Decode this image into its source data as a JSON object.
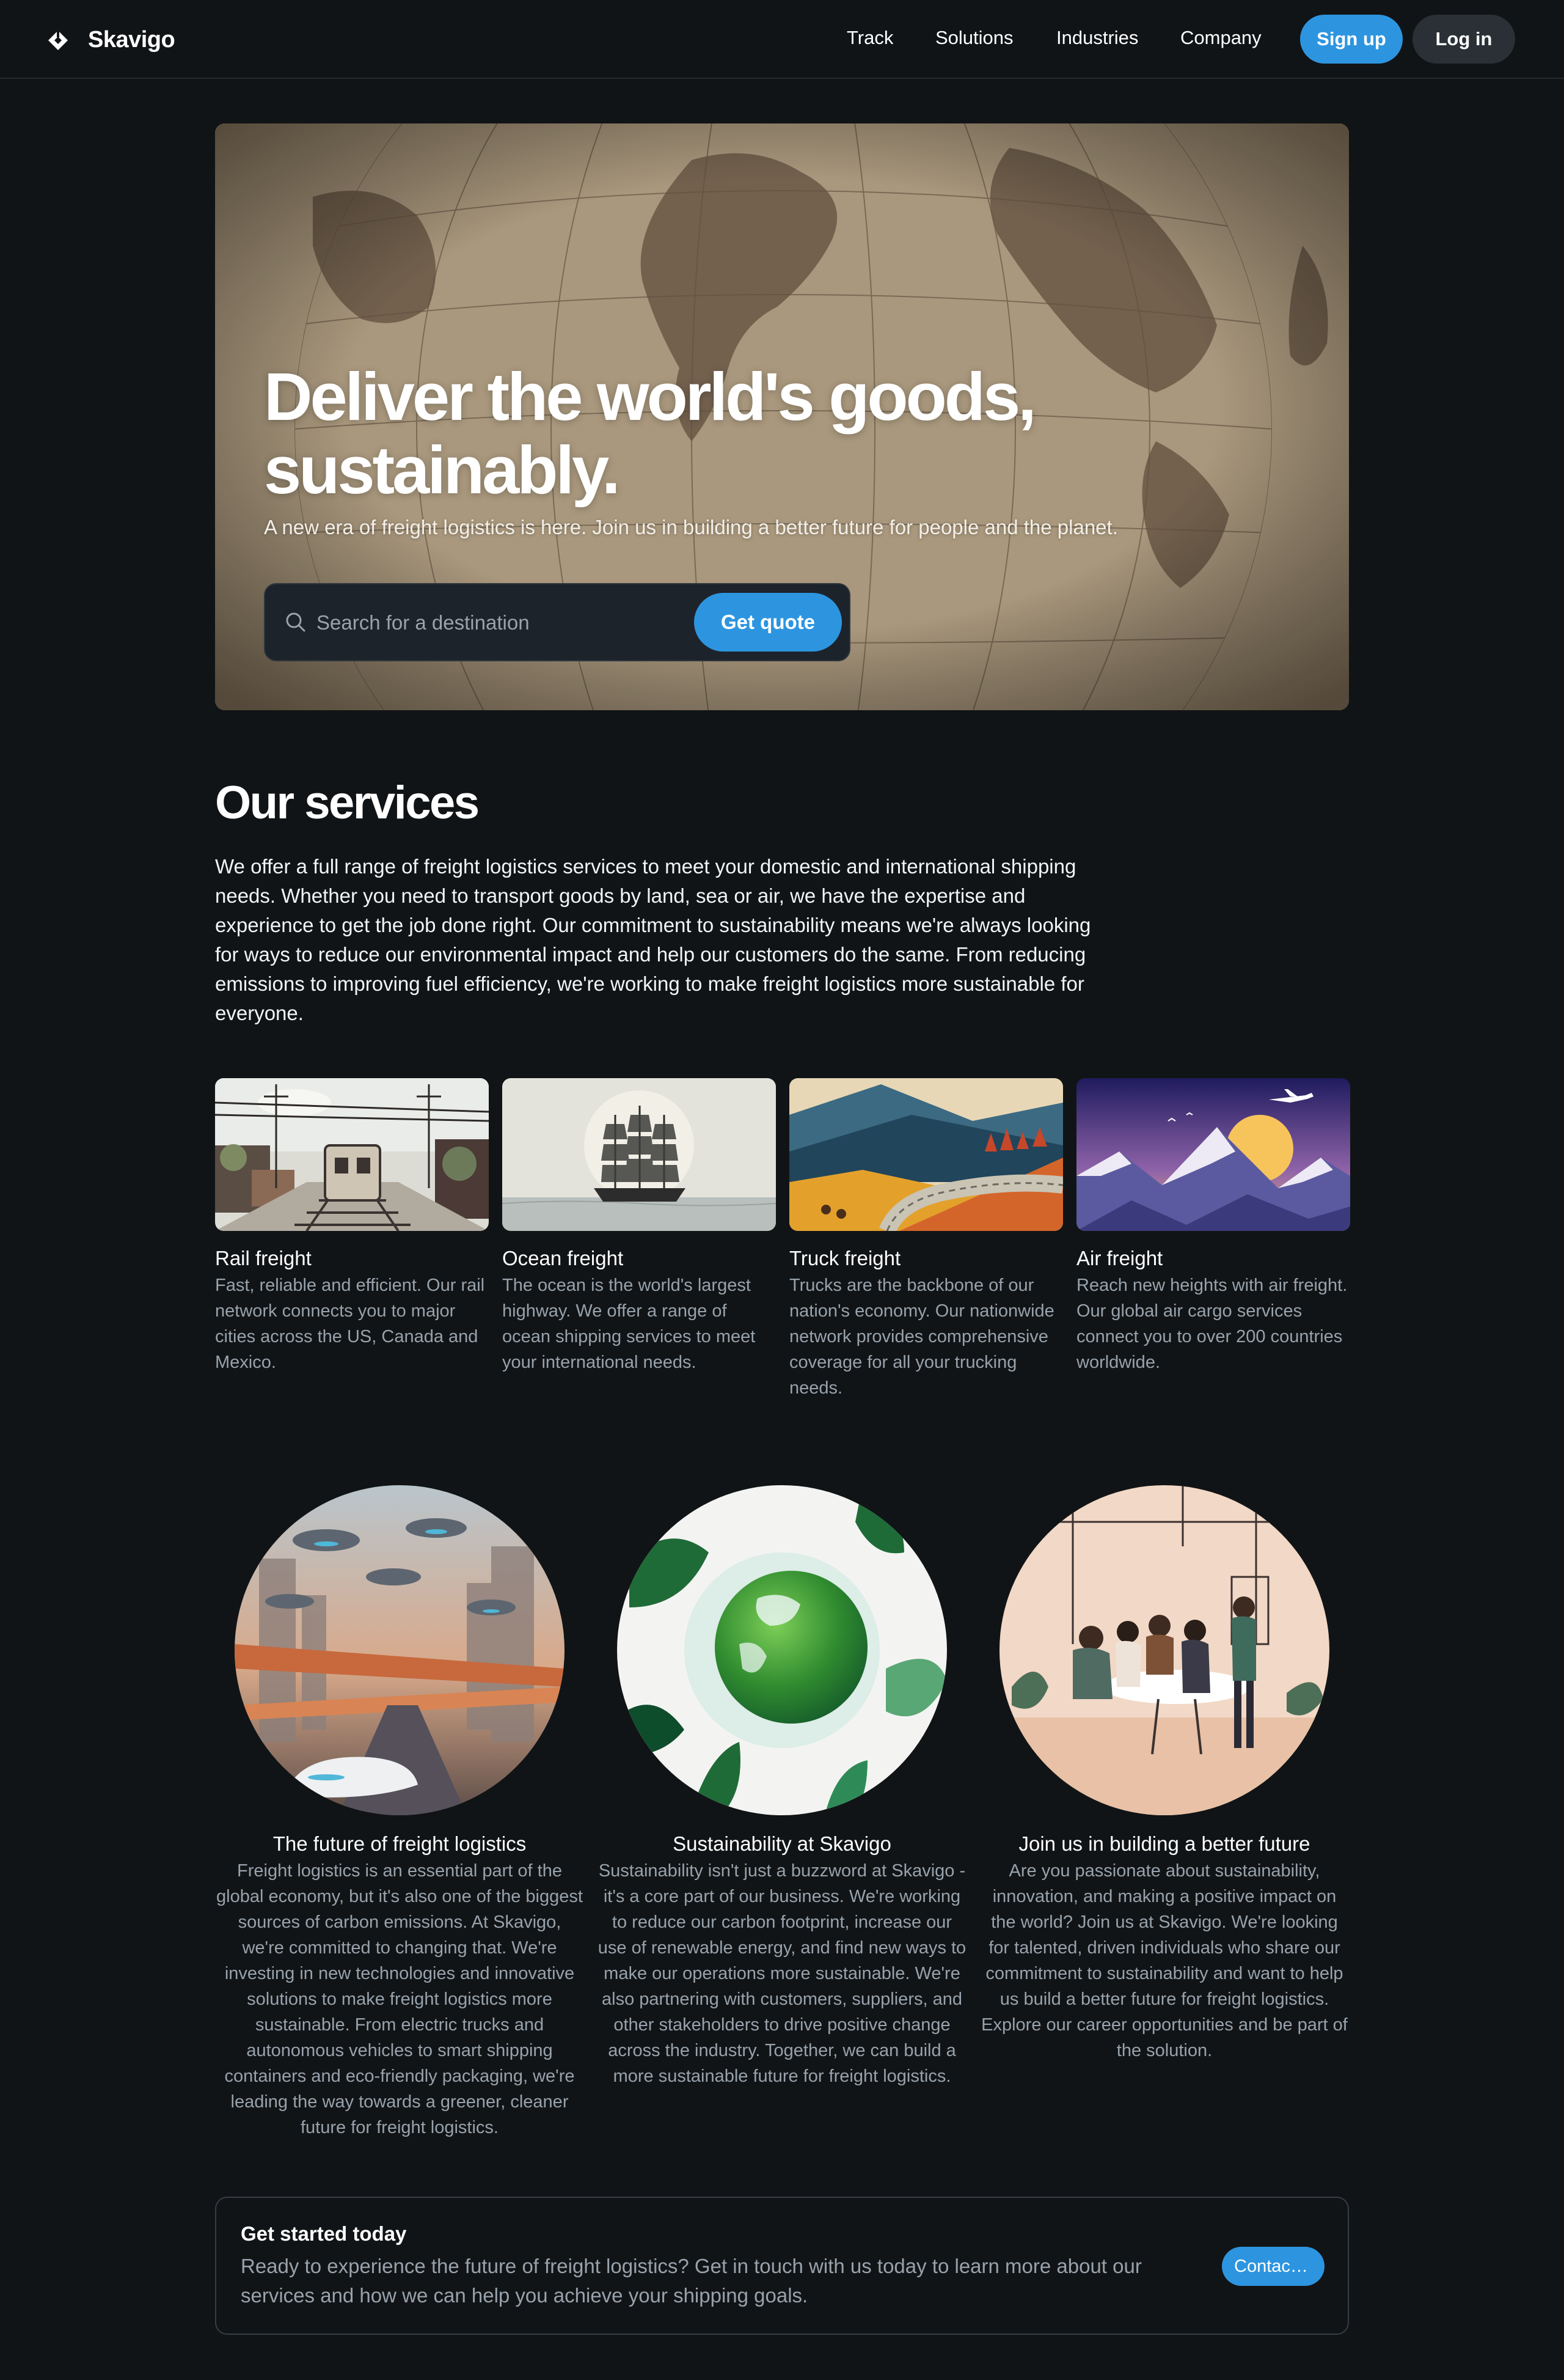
{
  "header": {
    "brand": "Skavigo",
    "nav": [
      "Track",
      "Solutions",
      "Industries",
      "Company"
    ],
    "signup_label": "Sign up",
    "login_label": "Log in"
  },
  "hero": {
    "title_line1": "Deliver the world's goods,",
    "title_line2": "sustainably.",
    "subtitle": "A new era of freight logistics is here. Join us in building a better future for people and the planet.",
    "search_placeholder": "Search for a destination",
    "quote_label": "Get quote"
  },
  "services": {
    "title": "Our services",
    "description": "We offer a full range of freight logistics services to meet your domestic and international shipping needs. Whether you need to transport goods by land, sea or air, we have the expertise and experience to get the job done right. Our commitment to sustainability means we're always looking for ways to reduce our environmental impact and help our customers do the same. From reducing emissions to improving fuel efficiency, we're working to make freight logistics more sustainable for everyone.",
    "cards": [
      {
        "title": "Rail freight",
        "text": "Fast, reliable and efficient. Our rail network connects you to major cities across the US, Canada and Mexico."
      },
      {
        "title": "Ocean freight",
        "text": "The ocean is the world's largest highway. We offer a range of ocean shipping services to meet your international needs."
      },
      {
        "title": "Truck freight",
        "text": "Trucks are the backbone of our nation's economy. Our nationwide network provides comprehensive coverage for all your trucking needs."
      },
      {
        "title": "Air freight",
        "text": "Reach new heights with air freight. Our global air cargo services connect you to over 200 countries worldwide."
      }
    ]
  },
  "features": [
    {
      "title": "The future of freight logistics",
      "text": "Freight logistics is an essential part of the global economy, but it's also one of the biggest sources of carbon emissions. At Skavigo, we're committed to changing that. We're investing in new technologies and innovative solutions to make freight logistics more sustainable. From electric trucks and autonomous vehicles to smart shipping containers and eco-friendly packaging, we're leading the way towards a greener, cleaner future for freight logistics."
    },
    {
      "title": "Sustainability at Skavigo",
      "text": "Sustainability isn't just a buzzword at Skavigo - it's a core part of our business. We're working to reduce our carbon footprint, increase our use of renewable energy, and find new ways to make our operations more sustainable. We're also partnering with customers, suppliers, and other stakeholders to drive positive change across the industry. Together, we can build a more sustainable future for freight logistics."
    },
    {
      "title": "Join us in building a better future",
      "text": "Are you passionate about sustainability, innovation, and making a positive impact on the world? Join us at Skavigo. We're looking for talented, driven individuals who share our commitment to sustainability and want to help us build a better future for freight logistics. Explore our career opportunities and be part of the solution."
    }
  ],
  "cta": {
    "title": "Get started today",
    "text": "Ready to experience the future of freight logistics? Get in touch with us today to learn more about our services and how we can help you achieve your shipping goals.",
    "button_label": "Contact us"
  },
  "colors": {
    "background": "#111416",
    "accent": "#2d95e0",
    "muted_text": "#98a2ac",
    "secondary_button": "#2a3036"
  },
  "icons": [
    "diamond-logo-icon",
    "search-icon"
  ]
}
